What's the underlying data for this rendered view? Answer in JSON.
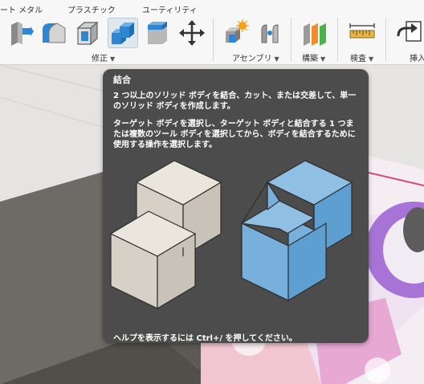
{
  "toolbar": {
    "tabs": [
      {
        "label": "ート メタル"
      },
      {
        "label": "プラスチック"
      },
      {
        "label": "ユーティリティ"
      }
    ],
    "groups": [
      {
        "label": "修正",
        "caret": "▼"
      },
      {
        "label": "アセンブリ",
        "caret": "▼"
      },
      {
        "label": "構築",
        "caret": "▼"
      },
      {
        "label": "検査",
        "caret": "▼"
      },
      {
        "label": "挿入"
      }
    ],
    "tools": [
      {
        "icon": "press-pull-icon"
      },
      {
        "icon": "fillet-icon"
      },
      {
        "icon": "shell-icon"
      },
      {
        "icon": "combine-icon",
        "active": true
      },
      {
        "icon": "replace-face-icon"
      },
      {
        "icon": "move-copy-icon"
      },
      {
        "icon": "new-component-icon"
      },
      {
        "icon": "joint-icon"
      },
      {
        "icon": "offset-plane-icon"
      },
      {
        "icon": "measure-icon"
      },
      {
        "icon": "insert-icon"
      }
    ]
  },
  "tooltip": {
    "title": "結合",
    "description": "2 つ以上のソリッド ボディを結合、カット、または交差して、単一のソリッド ボディを作成します。",
    "instruction": "ターゲット ボディを選択し、ターゲット ボディと結合する 1 つまたは複数のツール ボディを選択してから、ボディを結合するために使用する操作を選択します。",
    "help": "ヘルプを表示するには Ctrl+/ を押してください。"
  },
  "colors": {
    "tooltip_bg": "#4c4c4c",
    "accent_blue": "#3c8fd6",
    "toolbar_bg": "#f7f7f7"
  }
}
